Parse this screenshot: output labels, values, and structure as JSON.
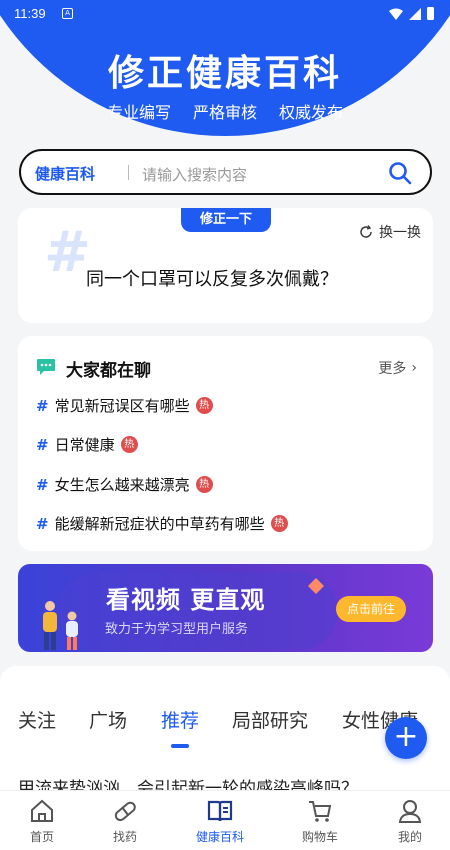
{
  "status_bar": {
    "time": "11:39",
    "notification": "A"
  },
  "header": {
    "title": "修正健康百科",
    "tags": [
      "专业编写",
      "严格审核",
      "权威发布"
    ]
  },
  "search": {
    "label": "健康百科",
    "placeholder": "请输入搜索内容"
  },
  "fix_card": {
    "badge": "修正一下",
    "refresh_label": "换一换",
    "question": "同一个口罩可以反复多次佩戴？"
  },
  "chat_card": {
    "title": "大家都在聊",
    "more_label": "更多",
    "topics": [
      {
        "text": "常见新冠误区有哪些",
        "badge": "热"
      },
      {
        "text": "日常健康",
        "badge": "热"
      },
      {
        "text": "女生怎么越来越漂亮",
        "badge": "热"
      },
      {
        "text": "能缓解新冠症状的中草药有哪些",
        "badge": "热"
      }
    ]
  },
  "banner": {
    "title": "看视频 更直观",
    "subtitle": "致力于为学习型用户服务",
    "cta": "点击前往"
  },
  "feed_tabs": {
    "items": [
      "关注",
      "广场",
      "推荐",
      "局部研究",
      "女性健康"
    ],
    "active_index": 2
  },
  "fab": {
    "label": "+"
  },
  "feed_peek": "甲流来势汹汹，会引起新一轮的感染高峰吗？",
  "bottom_nav": {
    "items": [
      {
        "label": "首页",
        "icon": "home-icon"
      },
      {
        "label": "找药",
        "icon": "pill-icon"
      },
      {
        "label": "健康百科",
        "icon": "book-icon"
      },
      {
        "label": "购物车",
        "icon": "cart-icon"
      },
      {
        "label": "我的",
        "icon": "profile-icon"
      }
    ],
    "active_index": 2
  },
  "colors": {
    "brand": "#1f5bf1",
    "hot": "#e04d4d",
    "cta": "#ffb82e"
  }
}
